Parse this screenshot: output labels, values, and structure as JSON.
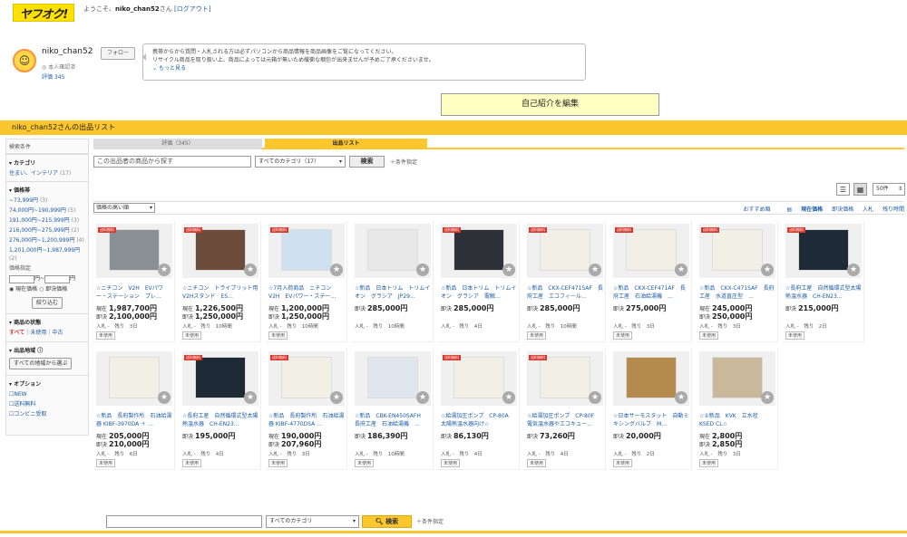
{
  "header": {
    "logo": "ヤフオク!",
    "welcome_prefix": "ようこそ、",
    "username": "niko_chan52",
    "welcome_suffix": "さん",
    "logout": "[ログアウト]"
  },
  "profile": {
    "name": "niko_chan52",
    "verified": "本人確認済",
    "rating_label": "評価",
    "rating_value": "345",
    "follow": "フォロー",
    "notice": [
      "携帯からから質問・入札される方は必ずパソコンから商品情報を商品画像をご覧になってください。",
      "リサイクル商品を取り扱い上、商品によっては元箱が無いため緩衝な梱包が出来ませんが予めご了承くださいませ。"
    ],
    "more": "もっと見る",
    "intro_button": "自己紹介を編集"
  },
  "list_title": "niko_chan52さんの出品リスト",
  "sidebar": {
    "header": "検索条件",
    "category_title": "カテゴリ",
    "category_item": "住まい、インテリア",
    "category_count": "(17)",
    "price_title": "価格帯",
    "prices": [
      {
        "label": "~73,999円",
        "count": "(3)"
      },
      {
        "label": "74,000円~190,999円",
        "count": "(5)"
      },
      {
        "label": "191,000円~215,999円",
        "count": "(3)"
      },
      {
        "label": "216,000円~275,999円",
        "count": "(2)"
      },
      {
        "label": "276,000円~1,200,999円",
        "count": "(4)"
      },
      {
        "label": "1,201,000円~1,987,999円",
        "count": "(2)"
      }
    ],
    "price_spec": "価格指定",
    "yen": "円",
    "tilde": "~",
    "current_price": "現在価格",
    "buyout_price": "即決価格",
    "narrow": "絞り込む",
    "condition_title": "商品の状態",
    "cond_all": "すべて",
    "cond_unused": "未使用",
    "cond_used": "中古",
    "region_title": "出品地域",
    "region_btn": "すべての地域から選ぶ",
    "option_title": "オプション",
    "options": [
      "NEW",
      "送料無料",
      "コンビニ受取"
    ]
  },
  "tabs": {
    "rating": "評価（345）",
    "list": "出品リスト"
  },
  "search": {
    "placeholder": "この出品者の商品から探す",
    "category": "すべてのカテゴリ（17）",
    "button": "検索",
    "condition": "条件指定"
  },
  "view": {
    "per_page": "50件"
  },
  "sort": {
    "select": "価格の高い順",
    "links": [
      "おすすめ順",
      "現在価格",
      "即決価格",
      "入札",
      "残り時間"
    ]
  },
  "items": [
    {
      "ship": "送料無料",
      "title": "☆ニチコン　V2H　EVパワー・ステーション　プレ…",
      "p1_label": "現在",
      "p1": "1,987,700円",
      "p2_label": "即決",
      "p2": "2,100,000円",
      "bids": "入札 -　残り　3日",
      "badge": "未使用"
    },
    {
      "ship": "送料無料",
      "title": "☆ニチコン　トライブリット用　V2Hスタンド　ES…",
      "p1_label": "現在",
      "p1": "1,226,500円",
      "p2_label": "即決",
      "p2": "1,250,000円",
      "bids": "入札 -　残り　10時間",
      "badge": "未使用"
    },
    {
      "ship": "送料無料",
      "title": "☆7月入荷商品　ニチコン　V2H　EVパワー・ステー…",
      "p1_label": "現在",
      "p1": "1,200,000円",
      "p2_label": "即決",
      "p2": "1,250,000円",
      "bids": "入札 -　残り　10時間",
      "badge": "未使用"
    },
    {
      "ship": "",
      "title": "☆新品　日本トリム　トリムイオン　グラシア　JP29…",
      "p1_label": "即決",
      "p1": "285,000円",
      "p2_label": "",
      "p2": "",
      "bids": "入札 -　残り　10時間",
      "badge": ""
    },
    {
      "ship": "送料無料",
      "title": "☆新品　日本トリム　トリムイオン　グラシア　電解…",
      "p1_label": "即決",
      "p1": "285,000円",
      "p2_label": "",
      "p2": "",
      "bids": "入札 -　残り　4日",
      "badge": ""
    },
    {
      "ship": "送料無料",
      "title": "☆新品　CKX-CEF471SAF　長府工産　エコフィール…",
      "p1_label": "即決",
      "p1": "285,000円",
      "p2_label": "",
      "p2": "",
      "bids": "入札 -　残り　10時間",
      "badge": "未使用"
    },
    {
      "ship": "送料無料",
      "title": "☆新品　CKX-CEF471AF　長府工産　石油給湯機　…",
      "p1_label": "即決",
      "p1": "275,000円",
      "p2_label": "",
      "p2": "",
      "bids": "入札 -　残り　3日",
      "badge": "未使用"
    },
    {
      "ship": "送料無料",
      "title": "☆新品　CKX-C471SAF　長府工産　水道直圧型　…",
      "p1_label": "現在",
      "p1": "245,000円",
      "p2_label": "即決",
      "p2": "250,000円",
      "bids": "入札 -　残り　3日",
      "badge": "未使用"
    },
    {
      "ship": "送料無料",
      "title": "☆長府工産　自然循環式型太陽熱温水器　CH-EN23…",
      "p1_label": "即決",
      "p1": "215,000円",
      "p2_label": "",
      "p2": "",
      "bids": "入札 -　残り　2日",
      "badge": "未使用"
    },
    {
      "ship": "",
      "title": "☆新品　長府製作所　石油給湯器 KIBF-3970DA ＋ …",
      "p1_label": "現在",
      "p1": "205,000円",
      "p2_label": "即決",
      "p2": "210,000円",
      "bids": "入札 -　残り　6日",
      "badge": "未使用"
    },
    {
      "ship": "送料無料",
      "title": "☆長府工産　自然循環式型太陽熱温水器　CH-EN23…",
      "p1_label": "即決",
      "p1": "195,000円",
      "p2_label": "",
      "p2": "",
      "bids": "入札 -　残り　4日",
      "badge": "未使用"
    },
    {
      "ship": "送料無料",
      "title": "☆新品　長府製作所　石油給湯器 KIBF-4770DSA …",
      "p1_label": "現在",
      "p1": "190,000円",
      "p2_label": "即決",
      "p2": "207,960円",
      "bids": "入札 -　残り　3日",
      "badge": "未使用"
    },
    {
      "ship": "",
      "title": "☆新品　CBK-EN450SAFH　長府工産　石油給湯機　…",
      "p1_label": "即決",
      "p1": "186,390円",
      "p2_label": "",
      "p2": "",
      "bids": "入札 -　残り　10時間",
      "badge": "未使用"
    },
    {
      "ship": "送料無料",
      "title": "☆給湯加圧ポンプ　CP-80A　太陽熱温水器向け☆",
      "p1_label": "即決",
      "p1": "86,130円",
      "p2_label": "",
      "p2": "",
      "bids": "入札 -　残り　4日",
      "badge": "未使用"
    },
    {
      "ship": "送料無料",
      "title": "☆給湯加圧ポンプ　CP-80F　電気温水器やエコキュー…",
      "p1_label": "即決",
      "p1": "73,260円",
      "p2_label": "",
      "p2": "",
      "bids": "入札 -　残り　4日",
      "badge": "未使用"
    },
    {
      "ship": "",
      "title": "☆日本サーモスタット　自動ミキシングバルブ　M…",
      "p1_label": "即決",
      "p1": "20,000円",
      "p2_label": "",
      "p2": "",
      "bids": "入札 -　残り　2日",
      "badge": "未使用"
    },
    {
      "ship": "",
      "title": "☆①新品　KVK　立水栓　KSED CL☆",
      "p1_label": "現在",
      "p1": "2,800円",
      "p2_label": "即決",
      "p2": "2,850円",
      "bids": "入札 -　残り　3日",
      "badge": "未使用"
    }
  ],
  "bottom": {
    "category": "すべてのカテゴリ",
    "button": "検索",
    "condition": "条件指定"
  },
  "colors": {
    "brand_yellow": "#fcc72c",
    "logo_yellow": "#ffe100",
    "link": "#1a5aa6",
    "free_shipping_red": "#d9362b"
  }
}
